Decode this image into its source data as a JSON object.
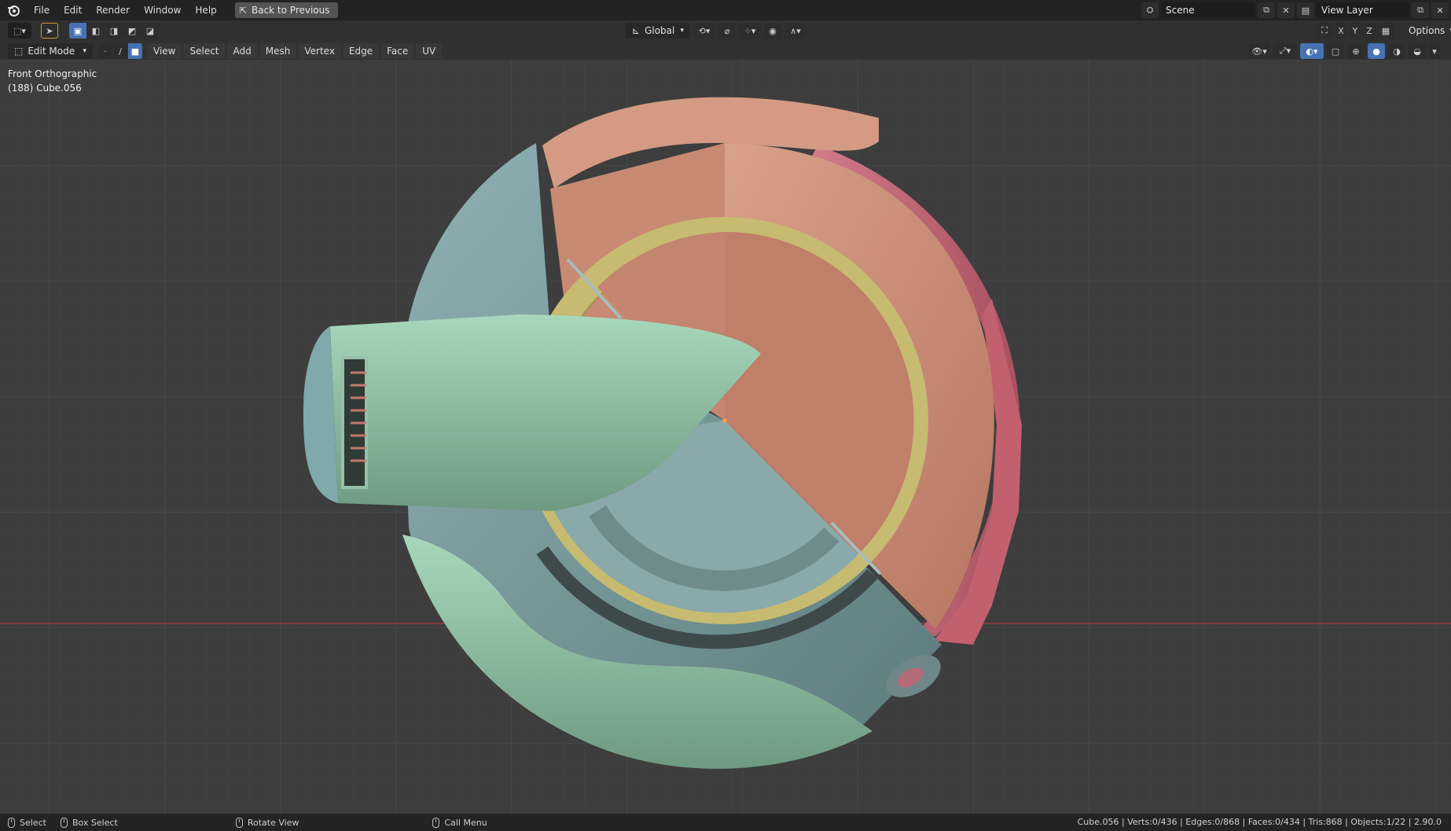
{
  "menubar": {
    "items": [
      "File",
      "Edit",
      "Render",
      "Window",
      "Help"
    ],
    "back_button": "Back to Previous",
    "scene_name": "Scene",
    "view_layer_name": "View Layer"
  },
  "toolbar": {
    "transform_orientation": "Global",
    "axes": [
      "X",
      "Y",
      "Z"
    ],
    "options_label": "Options"
  },
  "header": {
    "mode": "Edit Mode",
    "menus": [
      "View",
      "Select",
      "Add",
      "Mesh",
      "Vertex",
      "Edge",
      "Face",
      "UV"
    ]
  },
  "viewport": {
    "view_name": "Front Orthographic",
    "object_label": "(188) Cube.056"
  },
  "statusbar": {
    "select": "Select",
    "box_select": "Box Select",
    "rotate_view": "Rotate View",
    "call_menu": "Call Menu",
    "stats": "Cube.056 | Verts:0/436 | Edges:0/868 | Faces:0/434 | Tris:868 | Objects:1/22 | 2.90.0"
  },
  "colors": {
    "salmon": "#c98b72",
    "pink": "#c96a7c",
    "yellow": "#c8bb6e",
    "teal": "#7d9c9c",
    "green": "#8dbb9b",
    "grid": "#474747",
    "axis_x": "#9a3b3b"
  }
}
